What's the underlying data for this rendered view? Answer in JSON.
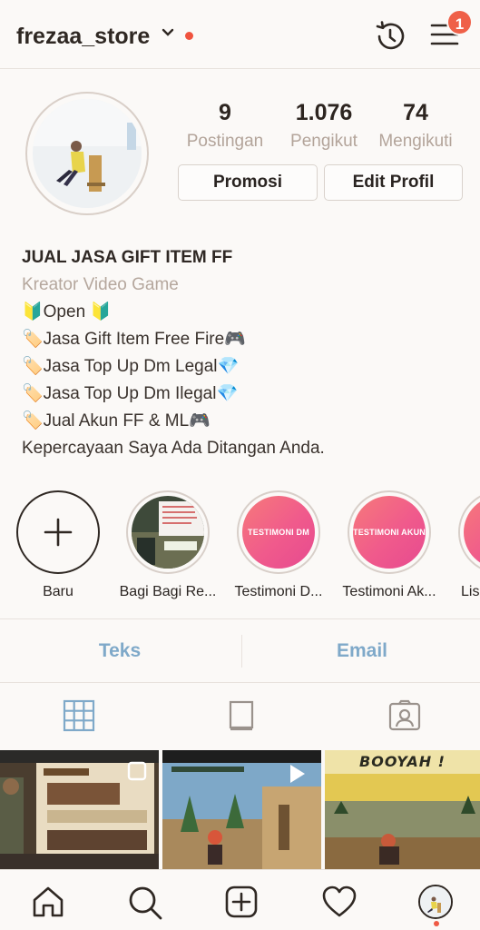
{
  "header": {
    "username": "frezaa_store",
    "notification_count": "1"
  },
  "profile": {
    "stats": [
      {
        "value": "9",
        "label": "Postingan"
      },
      {
        "value": "1.076",
        "label": "Pengikut"
      },
      {
        "value": "74",
        "label": "Mengikuti"
      }
    ],
    "buttons": {
      "promote": "Promosi",
      "edit_profile": "Edit Profil"
    }
  },
  "bio": {
    "name": "JUAL JASA GIFT ITEM FF",
    "category": "Kreator Video Game",
    "lines": [
      "🔰Open 🔰",
      "🏷️Jasa Gift Item Free Fire🎮",
      "🏷️Jasa Top Up Dm Legal💎",
      "🏷️Jasa Top Up Dm Ilegal💎",
      "🏷️Jual Akun FF & ML🎮",
      "Kepercayaan Saya Ada Ditangan Anda."
    ]
  },
  "highlights": [
    {
      "label": "Baru",
      "cover_text": ""
    },
    {
      "label": "Bagi Bagi Re...",
      "cover_text": ""
    },
    {
      "label": "Testimoni D...",
      "cover_text": "TESTIMONI DM FF"
    },
    {
      "label": "Testimoni Ak...",
      "cover_text": "TESTIMONI AKUN FF"
    },
    {
      "label": "Lis",
      "cover_text": ""
    }
  ],
  "contact": {
    "text": "Teks",
    "email": "Email"
  },
  "posts": [
    {
      "overlay": ""
    },
    {
      "overlay": ""
    },
    {
      "overlay": "BOOYAH !"
    }
  ],
  "colors": {
    "accent_link": "#7fa9c9",
    "badge": "#ef6048",
    "highlight_gradient_start": "#f67a7a",
    "highlight_gradient_end": "#e64a8f"
  }
}
